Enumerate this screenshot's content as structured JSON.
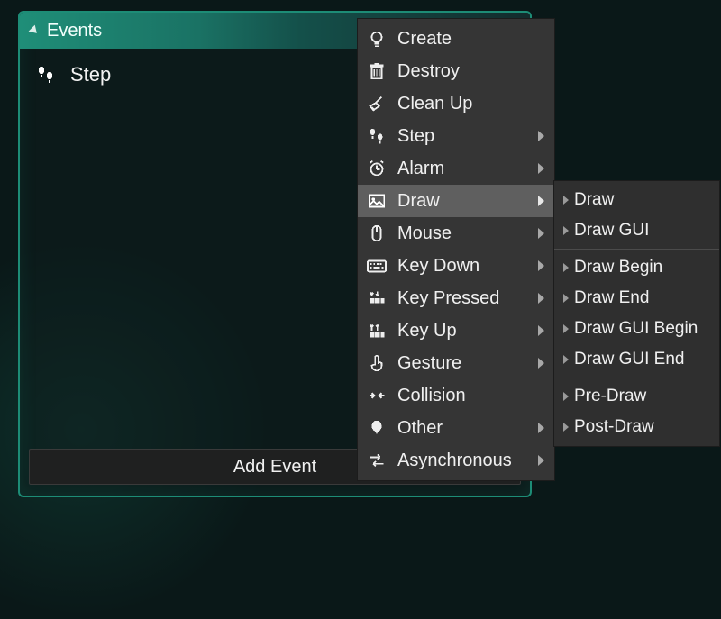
{
  "panel": {
    "title": "Events",
    "event_items": [
      {
        "label": "Step",
        "icon": "footsteps-icon"
      }
    ],
    "add_button_label": "Add Event"
  },
  "menu": {
    "items": [
      {
        "label": "Create",
        "icon": "bulb-icon",
        "submenu": false
      },
      {
        "label": "Destroy",
        "icon": "trash-icon",
        "submenu": false
      },
      {
        "label": "Clean Up",
        "icon": "broom-icon",
        "submenu": false
      },
      {
        "label": "Step",
        "icon": "footsteps-icon",
        "submenu": true
      },
      {
        "label": "Alarm",
        "icon": "alarm-icon",
        "submenu": true
      },
      {
        "label": "Draw",
        "icon": "image-icon",
        "submenu": true,
        "highlight": true
      },
      {
        "label": "Mouse",
        "icon": "mouse-icon",
        "submenu": true
      },
      {
        "label": "Key Down",
        "icon": "keyboard-icon",
        "submenu": true
      },
      {
        "label": "Key Pressed",
        "icon": "keypress-icon",
        "submenu": true
      },
      {
        "label": "Key Up",
        "icon": "keyup-icon",
        "submenu": true
      },
      {
        "label": "Gesture",
        "icon": "gesture-icon",
        "submenu": true
      },
      {
        "label": "Collision",
        "icon": "collision-icon",
        "submenu": false
      },
      {
        "label": "Other",
        "icon": "other-icon",
        "submenu": true
      },
      {
        "label": "Asynchronous",
        "icon": "async-icon",
        "submenu": true
      }
    ]
  },
  "submenu": {
    "groups": [
      [
        "Draw",
        "Draw GUI"
      ],
      [
        "Draw Begin",
        "Draw End",
        "Draw GUI Begin",
        "Draw GUI End"
      ],
      [
        "Pre-Draw",
        "Post-Draw"
      ]
    ]
  }
}
